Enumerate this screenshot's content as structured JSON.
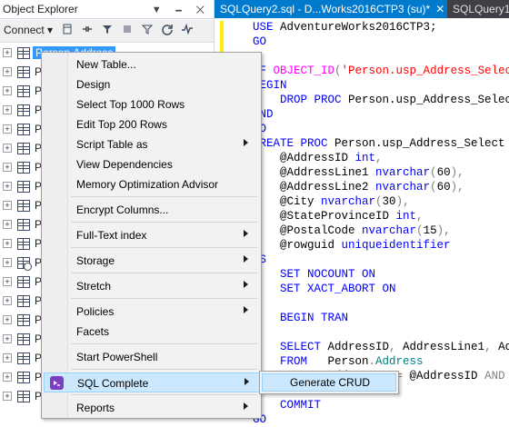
{
  "object_explorer": {
    "title": "Object Explorer",
    "title_buttons": "▼ 🗕 ✕",
    "toolbar": {
      "connect_label": "Connect",
      "connect_arrow": "▾",
      "icons": [
        "connect-db-icon",
        "disconnect-icon",
        "stop-icon",
        "filter-icon",
        "refresh-icon",
        "activity-monitor-icon"
      ]
    },
    "tree_items": [
      {
        "label": "Person.Address",
        "selected": true,
        "history": false
      },
      {
        "label": "Person.",
        "selected": false,
        "history": false
      },
      {
        "label": "Person.",
        "selected": false,
        "history": false
      },
      {
        "label": "Person.",
        "selected": false,
        "history": false
      },
      {
        "label": "Person.",
        "selected": false,
        "history": false
      },
      {
        "label": "Person.",
        "selected": false,
        "history": false
      },
      {
        "label": "Person.",
        "selected": false,
        "history": false
      },
      {
        "label": "Person.",
        "selected": false,
        "history": false
      },
      {
        "label": "Person.",
        "selected": false,
        "history": false
      },
      {
        "label": "Person.",
        "selected": false,
        "history": false
      },
      {
        "label": "Person.",
        "selected": false,
        "history": false
      },
      {
        "label": "Person.",
        "selected": false,
        "history": true
      },
      {
        "label": "Person.",
        "selected": false,
        "history": false
      },
      {
        "label": "Person.",
        "selected": false,
        "history": false
      },
      {
        "label": "Person.",
        "selected": false,
        "history": false
      },
      {
        "label": "Person.",
        "selected": false,
        "history": false
      },
      {
        "label": "Person.",
        "selected": false,
        "history": false
      },
      {
        "label": "Person.",
        "selected": false,
        "history": false
      },
      {
        "label": "Person.",
        "selected": false,
        "history": false
      }
    ]
  },
  "tabs": [
    {
      "label": "SQLQuery2.sql - D...Works2016CTP3 (su)*",
      "close": "✕",
      "active": true
    },
    {
      "label": "SQLQuery1",
      "active": false
    }
  ],
  "editor_lines": [
    [
      {
        "t": "USE ",
        "c": "kw"
      },
      {
        "t": "AdventureWorks2016CTP3;",
        "c": ""
      }
    ],
    [
      {
        "t": "GO",
        "c": "kw"
      }
    ],
    [],
    [
      {
        "t": "IF ",
        "c": "kw"
      },
      {
        "t": "OBJECT_ID",
        "c": "fn"
      },
      {
        "t": "(",
        "c": "gray"
      },
      {
        "t": "'Person.usp_Address_Select'",
        "c": "str"
      }
    ],
    [
      {
        "t": "BEGIN",
        "c": "kw"
      }
    ],
    [
      {
        "t": "    DROP PROC ",
        "c": "kw"
      },
      {
        "t": "Person.usp_Address_Select",
        "c": ""
      }
    ],
    [
      {
        "t": "END",
        "c": "kw"
      }
    ],
    [
      {
        "t": "GO",
        "c": "kw"
      }
    ],
    [
      {
        "t": "CREATE PROC ",
        "c": "kw"
      },
      {
        "t": "Person.usp_Address_Select",
        "c": ""
      }
    ],
    [
      {
        "t": "    @AddressID ",
        "c": ""
      },
      {
        "t": "int",
        "c": "kw"
      },
      {
        "t": ",",
        "c": "gray"
      }
    ],
    [
      {
        "t": "    @AddressLine1 ",
        "c": ""
      },
      {
        "t": "nvarchar",
        "c": "kw"
      },
      {
        "t": "(",
        "c": "gray"
      },
      {
        "t": "60",
        "c": ""
      },
      {
        "t": "),",
        "c": "gray"
      }
    ],
    [
      {
        "t": "    @AddressLine2 ",
        "c": ""
      },
      {
        "t": "nvarchar",
        "c": "kw"
      },
      {
        "t": "(",
        "c": "gray"
      },
      {
        "t": "60",
        "c": ""
      },
      {
        "t": "),",
        "c": "gray"
      }
    ],
    [
      {
        "t": "    @City ",
        "c": ""
      },
      {
        "t": "nvarchar",
        "c": "kw"
      },
      {
        "t": "(",
        "c": "gray"
      },
      {
        "t": "30",
        "c": ""
      },
      {
        "t": "),",
        "c": "gray"
      }
    ],
    [
      {
        "t": "    @StateProvinceID ",
        "c": ""
      },
      {
        "t": "int",
        "c": "kw"
      },
      {
        "t": ",",
        "c": "gray"
      }
    ],
    [
      {
        "t": "    @PostalCode ",
        "c": ""
      },
      {
        "t": "nvarchar",
        "c": "kw"
      },
      {
        "t": "(",
        "c": "gray"
      },
      {
        "t": "15",
        "c": ""
      },
      {
        "t": "),",
        "c": "gray"
      }
    ],
    [
      {
        "t": "    @rowguid ",
        "c": ""
      },
      {
        "t": "uniqueidentifier",
        "c": "kw"
      }
    ],
    [
      {
        "t": "AS",
        "c": "kw"
      }
    ],
    [
      {
        "t": "    SET NOCOUNT ON",
        "c": "kw"
      }
    ],
    [
      {
        "t": "    SET XACT_ABORT ON",
        "c": "kw"
      }
    ],
    [],
    [
      {
        "t": "    BEGIN TRAN",
        "c": "kw"
      }
    ],
    [],
    [
      {
        "t": "    SELECT ",
        "c": "kw"
      },
      {
        "t": "AddressID",
        "c": ""
      },
      {
        "t": ", ",
        "c": "gray"
      },
      {
        "t": "AddressLine1",
        "c": ""
      },
      {
        "t": ", ",
        "c": "gray"
      },
      {
        "t": "Addr",
        "c": ""
      }
    ],
    [
      {
        "t": "    FROM   ",
        "c": "kw"
      },
      {
        "t": "Person",
        "c": ""
      },
      {
        "t": ".",
        "c": "gray"
      },
      {
        "t": "Address",
        "c": "tl"
      }
    ],
    [
      {
        "t": "    WHERE  ",
        "c": "kw"
      },
      {
        "t": "AddressID ",
        "c": ""
      },
      {
        "t": "= ",
        "c": "gray"
      },
      {
        "t": "@AddressID ",
        "c": ""
      },
      {
        "t": "AND ",
        "c": "gray"
      },
      {
        "t": "Add",
        "c": ""
      }
    ],
    [],
    [
      {
        "t": "    COMMIT",
        "c": "kw"
      }
    ],
    [
      {
        "t": "GO",
        "c": "kw"
      }
    ]
  ],
  "context_menu": {
    "items": [
      {
        "label": "New Table...",
        "submenu": false
      },
      {
        "label": "Design",
        "submenu": false
      },
      {
        "label": "Select Top 1000 Rows",
        "submenu": false
      },
      {
        "label": "Edit Top 200 Rows",
        "submenu": false
      },
      {
        "label": "Script Table as",
        "submenu": true
      },
      {
        "label": "View Dependencies",
        "submenu": false
      },
      {
        "label": "Memory Optimization Advisor",
        "submenu": false,
        "sep_after": true
      },
      {
        "label": "Encrypt Columns...",
        "submenu": false,
        "sep_after": true
      },
      {
        "label": "Full-Text index",
        "submenu": true,
        "sep_after": true
      },
      {
        "label": "Storage",
        "submenu": true,
        "sep_after": true
      },
      {
        "label": "Stretch",
        "submenu": true,
        "sep_after": true
      },
      {
        "label": "Policies",
        "submenu": true
      },
      {
        "label": "Facets",
        "submenu": false,
        "sep_after": true
      },
      {
        "label": "Start PowerShell",
        "submenu": false,
        "sep_after": true
      },
      {
        "label": "SQL Complete",
        "submenu": true,
        "highlighted": true,
        "sep_after": true,
        "icon": "sql-complete-icon"
      },
      {
        "label": "Reports",
        "submenu": true
      }
    ]
  },
  "submenu": {
    "label": "Generate CRUD"
  },
  "colors": {
    "accent": "#007acc",
    "selection": "#3399ff",
    "menu_highlight": "#cce8ff",
    "sql_complete": "#7b3fc4"
  }
}
